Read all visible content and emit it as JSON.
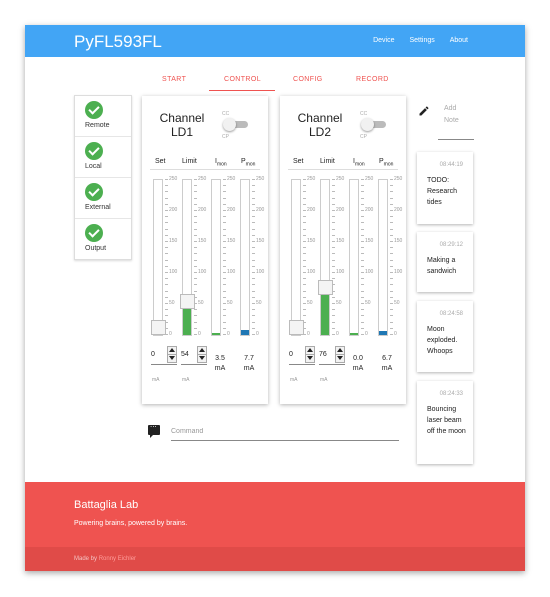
{
  "navbar": {
    "brand": "PyFL593FL",
    "links": [
      "Device",
      "Settings",
      "About"
    ]
  },
  "tabs": [
    "START",
    "CONTROL",
    "CONFIG",
    "RECORD"
  ],
  "active_tab": "CONTROL",
  "status": [
    {
      "label": "Remote",
      "ok": true
    },
    {
      "label": "Local",
      "ok": true
    },
    {
      "label": "External",
      "ok": true
    },
    {
      "label": "Output",
      "ok": true
    }
  ],
  "channels": [
    {
      "title_line1": "Channel",
      "title_line2": "LD1",
      "mode_top": "CC",
      "mode_bottom": "CP",
      "headers": {
        "set": "Set",
        "limit": "Limit",
        "imon": "I",
        "imon_sub": "mon",
        "pmon": "P",
        "pmon_sub": "mon"
      },
      "set_level": 0,
      "limit_level": 54,
      "imon_level": 3.5,
      "pmon_level": 7.7,
      "set_value": "0",
      "limit_value": "54",
      "imon_readout": "3.5",
      "imon_unit": "mA",
      "pmon_readout": "7.7",
      "pmon_unit": "mA",
      "set_unit": "mA",
      "limit_unit": "mA"
    },
    {
      "title_line1": "Channel",
      "title_line2": "LD2",
      "mode_top": "CC",
      "mode_bottom": "CP",
      "headers": {
        "set": "Set",
        "limit": "Limit",
        "imon": "I",
        "imon_sub": "mon",
        "pmon": "P",
        "pmon_sub": "mon"
      },
      "set_level": 0,
      "limit_level": 76,
      "imon_level": 0.0,
      "pmon_level": 6.7,
      "set_value": "0",
      "limit_value": "76",
      "imon_readout": "0.0",
      "imon_unit": "mA",
      "pmon_readout": "6.7",
      "pmon_unit": "mA",
      "set_unit": "mA",
      "limit_unit": "mA"
    }
  ],
  "scale_ticks": [
    "250",
    "200",
    "150",
    "100",
    "50",
    "0"
  ],
  "command": {
    "placeholder": "Command"
  },
  "notes_input": {
    "placeholder_line1": "Add",
    "placeholder_line2": "Note"
  },
  "notes": [
    {
      "time": "08:44:19",
      "text": "TODO: Research tides"
    },
    {
      "time": "08:29:12",
      "text": "Making a sandwich"
    },
    {
      "time": "08:24:58",
      "text": "Moon exploded. Whoops"
    },
    {
      "time": "08:24:33",
      "text": "Bouncing laser beam off the moon"
    }
  ],
  "footer": {
    "title": "Battaglia Lab",
    "subtitle": "Powering brains, powered by brains.",
    "made_by": "Made by",
    "author": "Ronny Eichler"
  },
  "colors": {
    "navbar": "#42a5f5",
    "accent": "#ef5350",
    "ok": "#4caf50",
    "fill_green": "#4caf50",
    "fill_blue": "#1f77b4"
  }
}
